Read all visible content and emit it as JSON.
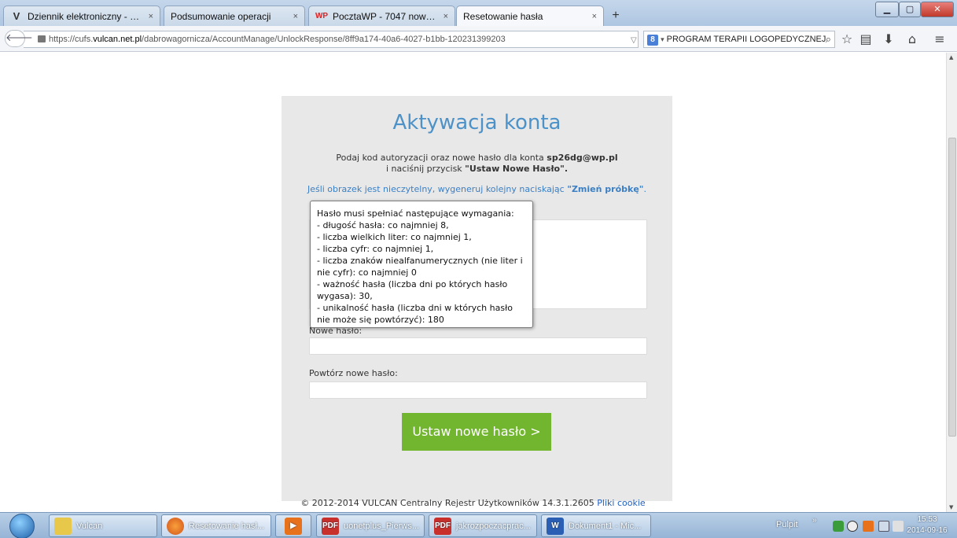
{
  "browser": {
    "tabs": [
      {
        "favicon": "V",
        "label": "Dziennik elektroniczny - e-...",
        "close": "×"
      },
      {
        "favicon": "",
        "label": "Podsumowanie operacji",
        "close": "×"
      },
      {
        "favicon": "WP",
        "label": "PocztaWP - 7047 nowych",
        "close": "×"
      },
      {
        "favicon": "",
        "label": "Resetowanie hasła",
        "close": "×"
      }
    ],
    "new_tab": "+",
    "url_prefix": "https://cufs.",
    "url_domain": "vulcan.net.pl",
    "url_path": "/dabrowagornicza/AccountManage/UnlockResponse/8ff9a174-40a6-4027-b1bb-120231399203",
    "search_text": "PROGRAM TERAPII LOGOPEDYCZNEJ"
  },
  "page": {
    "title": "Aktywacja konta",
    "intro_1": "Podaj kod autoryzacji oraz nowe hasło dla konta ",
    "intro_account": "sp26dg@wp.pl",
    "intro_2": "i naciśnij przycisk ",
    "intro_button_name": "\"Ustaw Nowe Hasło\".",
    "hint_text": "Jeśli obrazek jest nieczytelny, wygeneruj kolejny naciskając ",
    "hint_link": "\"Zmień próbkę\"",
    "hint_end": ".",
    "new_password_label": "Nowe hasło:",
    "repeat_password_label": "Powtórz nowe hasło:",
    "submit_label": "Ustaw nowe hasło >",
    "tooltip": "Hasło musi spełniać następujące wymagania:\n- długość hasła: co najmniej 8,\n- liczba wielkich liter: co najmniej 1,\n- liczba cyfr: co najmniej 1,\n- liczba znaków niealfanumerycznych (nie liter i nie cyfr): co najmniej 0\n- ważność hasła (liczba dni po których hasło wygasa): 30,\n- unikalność hasła (liczba dni w których hasło nie może się powtórzyć): 180",
    "footer_text": "© 2012-2014 VULCAN Centralny Rejestr Użytkowników 14.3.1.2605 ",
    "footer_link": "Pliki cookie"
  },
  "taskbar": {
    "items": [
      {
        "label": "Vulcan",
        "icon": "folder-icon"
      },
      {
        "label": "Resetowanie hasł...",
        "icon": "firefox-icon"
      },
      {
        "label": "",
        "icon": "media-player-icon"
      },
      {
        "label": "uonetplus_Pierws...",
        "icon": "pdf-icon"
      },
      {
        "label": "jakrozpoczacprac...",
        "icon": "pdf-icon"
      },
      {
        "label": "Dokument1 - Mic...",
        "icon": "word-icon"
      }
    ],
    "pulpit": "Pulpit",
    "time": "15:53",
    "date": "2014-09-16"
  }
}
